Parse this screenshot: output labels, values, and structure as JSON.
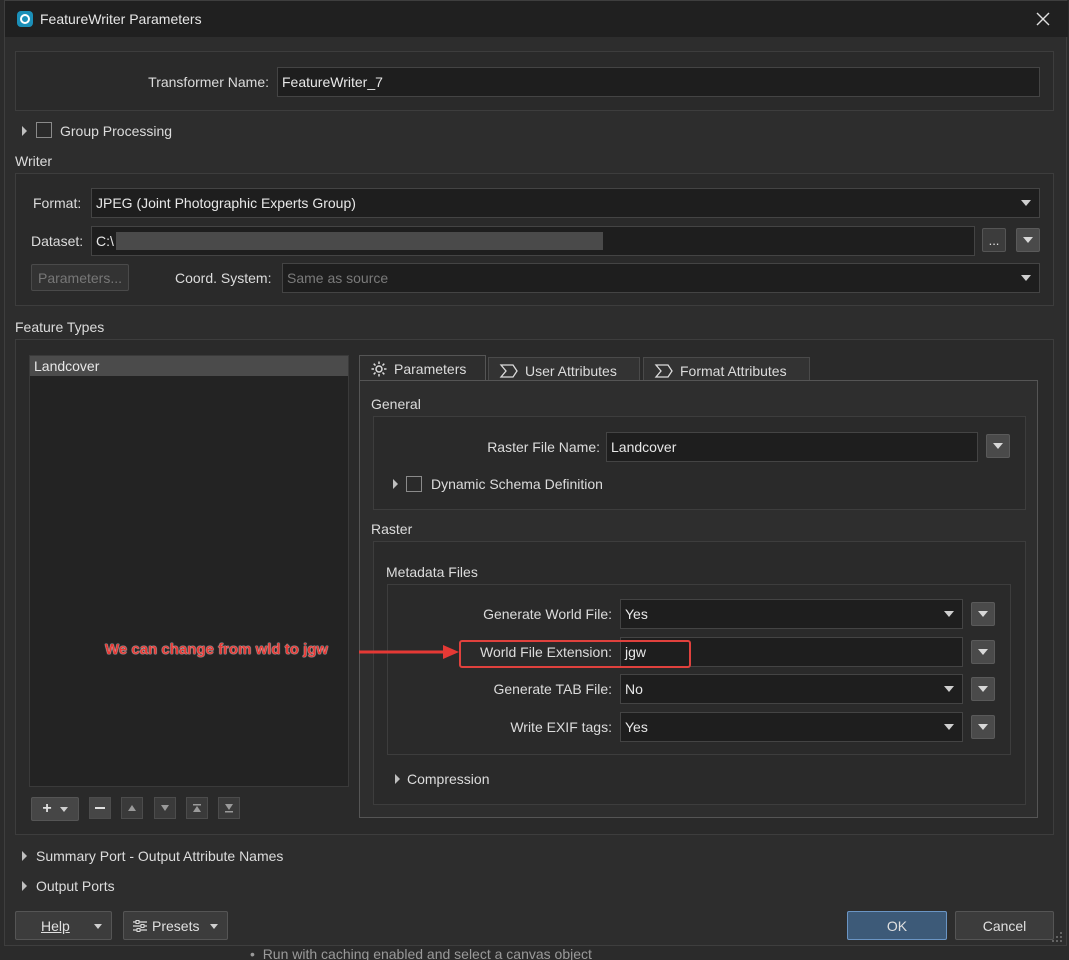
{
  "window": {
    "title": "FeatureWriter Parameters"
  },
  "transformer": {
    "name_label": "Transformer Name:",
    "name_value": "FeatureWriter_7"
  },
  "group_processing": {
    "label": "Group Processing"
  },
  "writer": {
    "section_label": "Writer",
    "format_label": "Format:",
    "format_value": "JPEG (Joint Photographic Experts Group)",
    "dataset_label": "Dataset:",
    "dataset_value": "C:\\",
    "browse_label": "...",
    "parameters_button": "Parameters...",
    "coord_label": "Coord. System:",
    "coord_value": "Same as source"
  },
  "feature_types": {
    "section_label": "Feature Types",
    "items": [
      "Landcover"
    ],
    "add_label": "+"
  },
  "tabs": [
    {
      "label": "Parameters",
      "icon": "gear-icon"
    },
    {
      "label": "User Attributes",
      "icon": "sigma-icon"
    },
    {
      "label": "Format Attributes",
      "icon": "sigma-icon"
    }
  ],
  "general": {
    "section_label": "General",
    "raster_label": "Raster File Name:",
    "raster_value": "Landcover",
    "dynamic_schema_label": "Dynamic Schema Definition"
  },
  "raster": {
    "section_label": "Raster",
    "metadata_label": "Metadata Files",
    "world_file_label": "Generate World File:",
    "world_file_value": "Yes",
    "extension_label": "World File Extension:",
    "extension_value": "jgw",
    "tab_file_label": "Generate TAB File:",
    "tab_file_value": "No",
    "exif_label": "Write EXIF tags:",
    "exif_value": "Yes",
    "compression_label": "Compression"
  },
  "annotation": {
    "text": "We can change from wld to jgw",
    "color": "#e53935"
  },
  "footer": {
    "summary_port_label": "Summary Port - Output Attribute Names",
    "output_ports_label": "Output Ports",
    "help_label": "Help",
    "presets_label": "Presets",
    "ok_label": "OK",
    "cancel_label": "Cancel"
  },
  "background_text": "Run with caching enabled and select a canvas object"
}
